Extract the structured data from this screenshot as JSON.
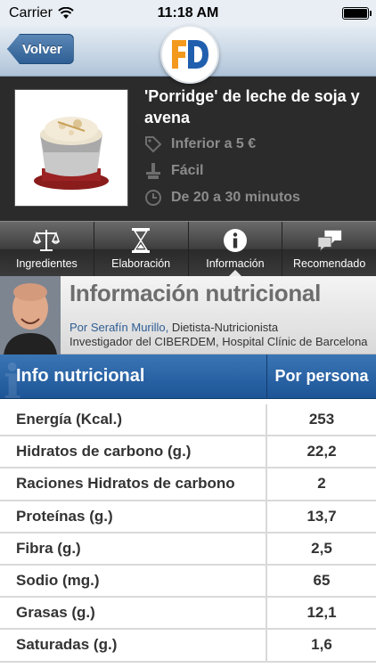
{
  "status": {
    "carrier": "Carrier",
    "time": "11:18 AM"
  },
  "nav": {
    "back_label": "Volver",
    "logo_text": "FD"
  },
  "recipe": {
    "title": "'Porridge' de leche de soja y avena",
    "price": "Inferior a 5 €",
    "difficulty": "Fácil",
    "time": "De 20 a 30 minutos"
  },
  "tabs": [
    {
      "label": "Ingredientes",
      "icon": "scale-icon"
    },
    {
      "label": "Elaboración",
      "icon": "hourglass-icon"
    },
    {
      "label": "Información",
      "icon": "info-icon",
      "active": true
    },
    {
      "label": "Recomendado",
      "icon": "chat-bubbles-icon"
    }
  ],
  "banner": {
    "title": "Información nutricional",
    "by": "Por Serafín Murillo,",
    "role": " Dietista-Nutricionista",
    "line2": "Investigador del CIBERDEM, Hospital Clínic de Barcelona"
  },
  "table": {
    "header_name": "Info nutricional",
    "header_value": "Por persona",
    "rows": [
      {
        "name": "Energía (Kcal.)",
        "value": "253"
      },
      {
        "name": "Hidratos de carbono (g.)",
        "value": "22,2"
      },
      {
        "name": "Raciones Hidratos de carbono",
        "value": "2"
      },
      {
        "name": "Proteínas (g.)",
        "value": "13,7"
      },
      {
        "name": "Fibra (g.)",
        "value": "2,5"
      },
      {
        "name": "Sodio (mg.)",
        "value": "65"
      },
      {
        "name": "Grasas (g.)",
        "value": "12,1"
      },
      {
        "name": "Saturadas (g.)",
        "value": "1,6"
      }
    ]
  },
  "colors": {
    "brand_orange": "#f39a1e",
    "brand_blue": "#1f5fae",
    "header_blue": "#1d5597"
  }
}
